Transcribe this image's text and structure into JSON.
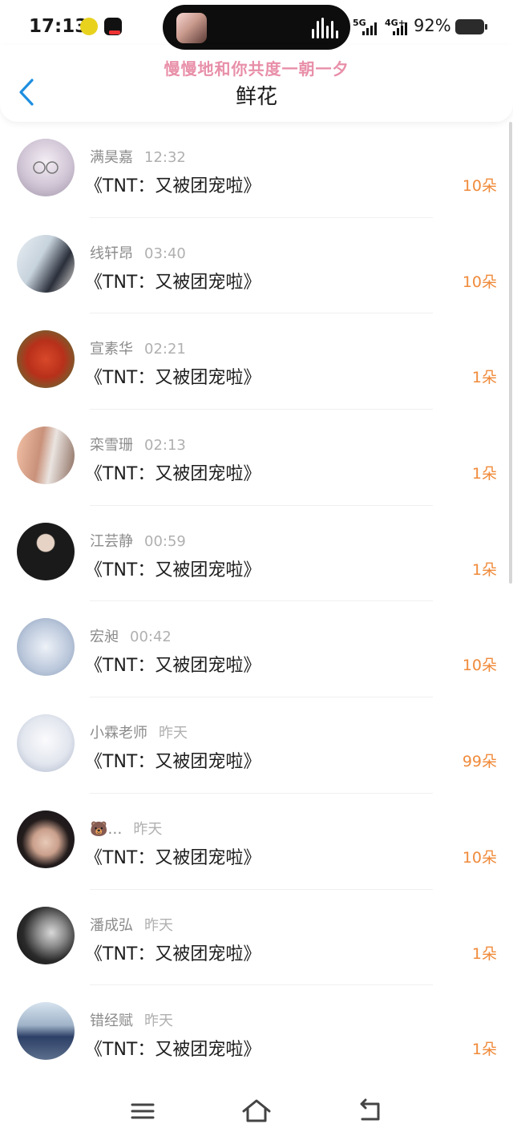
{
  "status_bar": {
    "time": "17:13",
    "network_1": "5G",
    "network_2": "4G+",
    "battery_percent": "92%"
  },
  "lyric": "慢慢地和你共度一朝一夕",
  "header": {
    "title": "鲜花"
  },
  "colors": {
    "accent_back": "#1e8fe0",
    "count": "#f08a3a",
    "lyric": "#e88fa9"
  },
  "rows": [
    {
      "name": "满昊嘉",
      "time": "12:32",
      "book": "《TNT：又被团宠啦》",
      "count": "10朵"
    },
    {
      "name": "线轩昂",
      "time": "03:40",
      "book": "《TNT：又被团宠啦》",
      "count": "10朵"
    },
    {
      "name": "宣素华",
      "time": "02:21",
      "book": "《TNT：又被团宠啦》",
      "count": "1朵"
    },
    {
      "name": "栾雪珊",
      "time": "02:13",
      "book": "《TNT：又被团宠啦》",
      "count": "1朵"
    },
    {
      "name": "江芸静",
      "time": "00:59",
      "book": "《TNT：又被团宠啦》",
      "count": "1朵"
    },
    {
      "name": "宏昶",
      "time": "00:42",
      "book": "《TNT：又被团宠啦》",
      "count": "10朵"
    },
    {
      "name": "小霖老师",
      "time": "昨天",
      "book": "《TNT：又被团宠啦》",
      "count": "99朵"
    },
    {
      "name": "🐻…",
      "time": "昨天",
      "book": "《TNT：又被团宠啦》",
      "count": "10朵"
    },
    {
      "name": "潘成弘",
      "time": "昨天",
      "book": "《TNT：又被团宠啦》",
      "count": "1朵"
    },
    {
      "name": "错经赋",
      "time": "昨天",
      "book": "《TNT：又被团宠啦》",
      "count": "1朵"
    }
  ],
  "icons": {
    "back": "chevron-left-icon",
    "nav_menu": "menu-icon",
    "nav_home": "home-icon",
    "nav_back": "return-icon"
  }
}
